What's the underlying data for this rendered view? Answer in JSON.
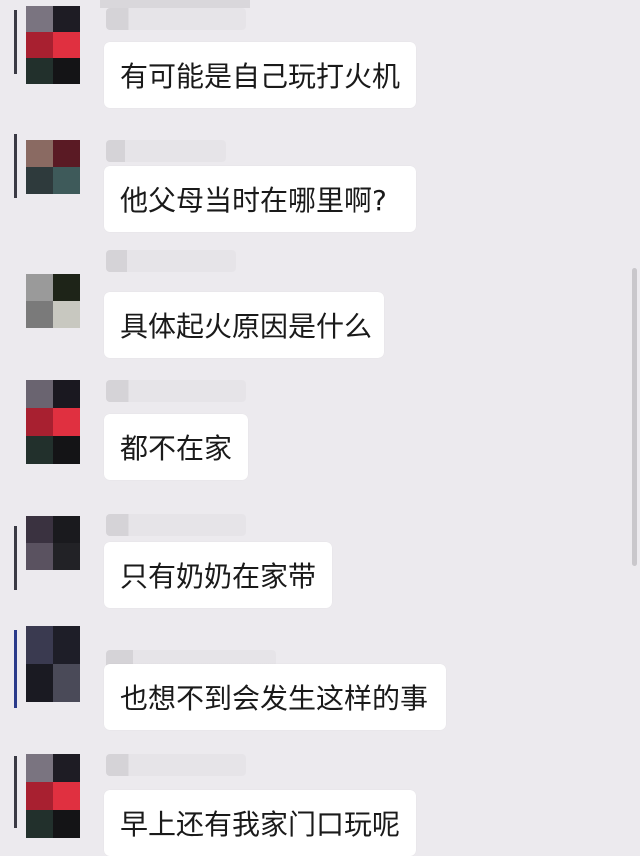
{
  "conversation": {
    "messages": [
      {
        "text": "有可能是自己玩打火机"
      },
      {
        "text": "他父母当时在哪里啊?"
      },
      {
        "text": "具体起火原因是什么"
      },
      {
        "text": "都不在家"
      },
      {
        "text": "只有奶奶在家带"
      },
      {
        "text": "也想不到会发生这样的事"
      },
      {
        "text": "早上还有我家门口玩呢"
      }
    ]
  },
  "colors": {
    "background": "#eceaee",
    "bubble": "#ffffff",
    "text": "#1a1a1a"
  }
}
